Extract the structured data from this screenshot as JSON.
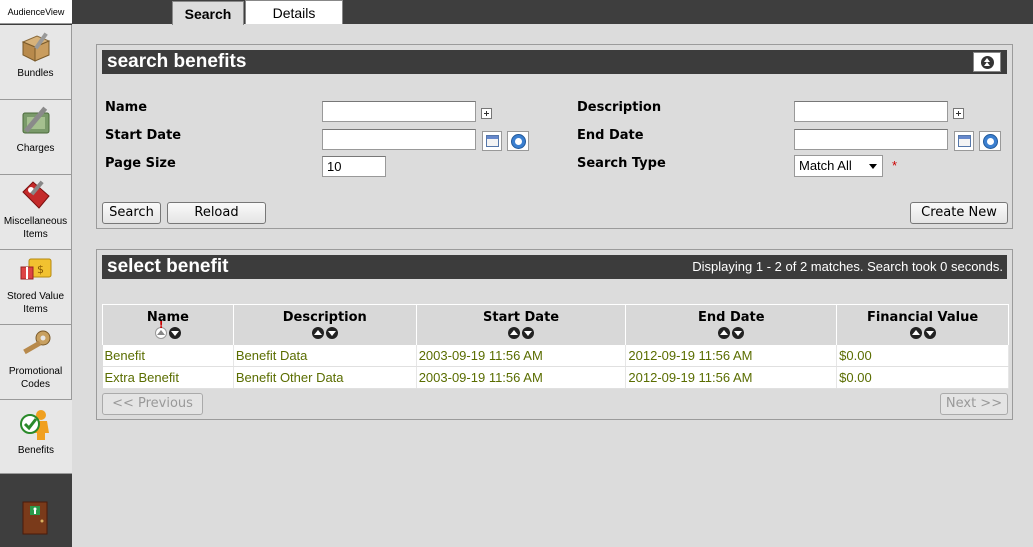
{
  "app": {
    "title": "AudienceView"
  },
  "sidebar": {
    "items": [
      {
        "label": "Bundles",
        "icon": "box-icon"
      },
      {
        "label": "Charges",
        "icon": "wrench-icon"
      },
      {
        "label": "Miscellaneous Items",
        "icon": "tag-icon"
      },
      {
        "label": "Stored Value Items",
        "icon": "gift-card-icon"
      },
      {
        "label": "Promotional Codes",
        "icon": "key-icon"
      },
      {
        "label": "Benefits",
        "icon": "benefit-person-icon"
      }
    ],
    "exit_icon": "exit-door-icon"
  },
  "tabs": {
    "search": "Search",
    "details": "Details"
  },
  "search_panel": {
    "title": "search benefits",
    "labels": {
      "name": "Name",
      "description": "Description",
      "start_date": "Start Date",
      "end_date": "End Date",
      "page_size": "Page Size",
      "search_type": "Search Type"
    },
    "values": {
      "name": "",
      "description": "",
      "start_date": "",
      "end_date": "",
      "page_size": "10",
      "search_type": "Match All"
    },
    "required_mark": "*",
    "buttons": {
      "search": "Search",
      "reload": "Reload",
      "create_new": "Create New"
    }
  },
  "select_panel": {
    "title": "select benefit",
    "match_info": "Displaying 1 - 2 of 2 matches. Search took 0 seconds.",
    "sort_mark": "!",
    "columns": [
      "Name",
      "Description",
      "Start Date",
      "End Date",
      "Financial Value"
    ],
    "rows": [
      [
        "Benefit",
        "Benefit Data",
        "2003-09-19 11:56 AM",
        "2012-09-19 11:56 AM",
        "$0.00"
      ],
      [
        "Extra Benefit",
        "Benefit Other Data",
        "2003-09-19 11:56 AM",
        "2012-09-19 11:56 AM",
        "$0.00"
      ]
    ],
    "pagination": {
      "previous": "<< Previous",
      "next": "Next >>"
    }
  },
  "colors": {
    "header_bg": "#3c3c3c",
    "row_text": "#5a6d00",
    "required": "#cc0000"
  }
}
